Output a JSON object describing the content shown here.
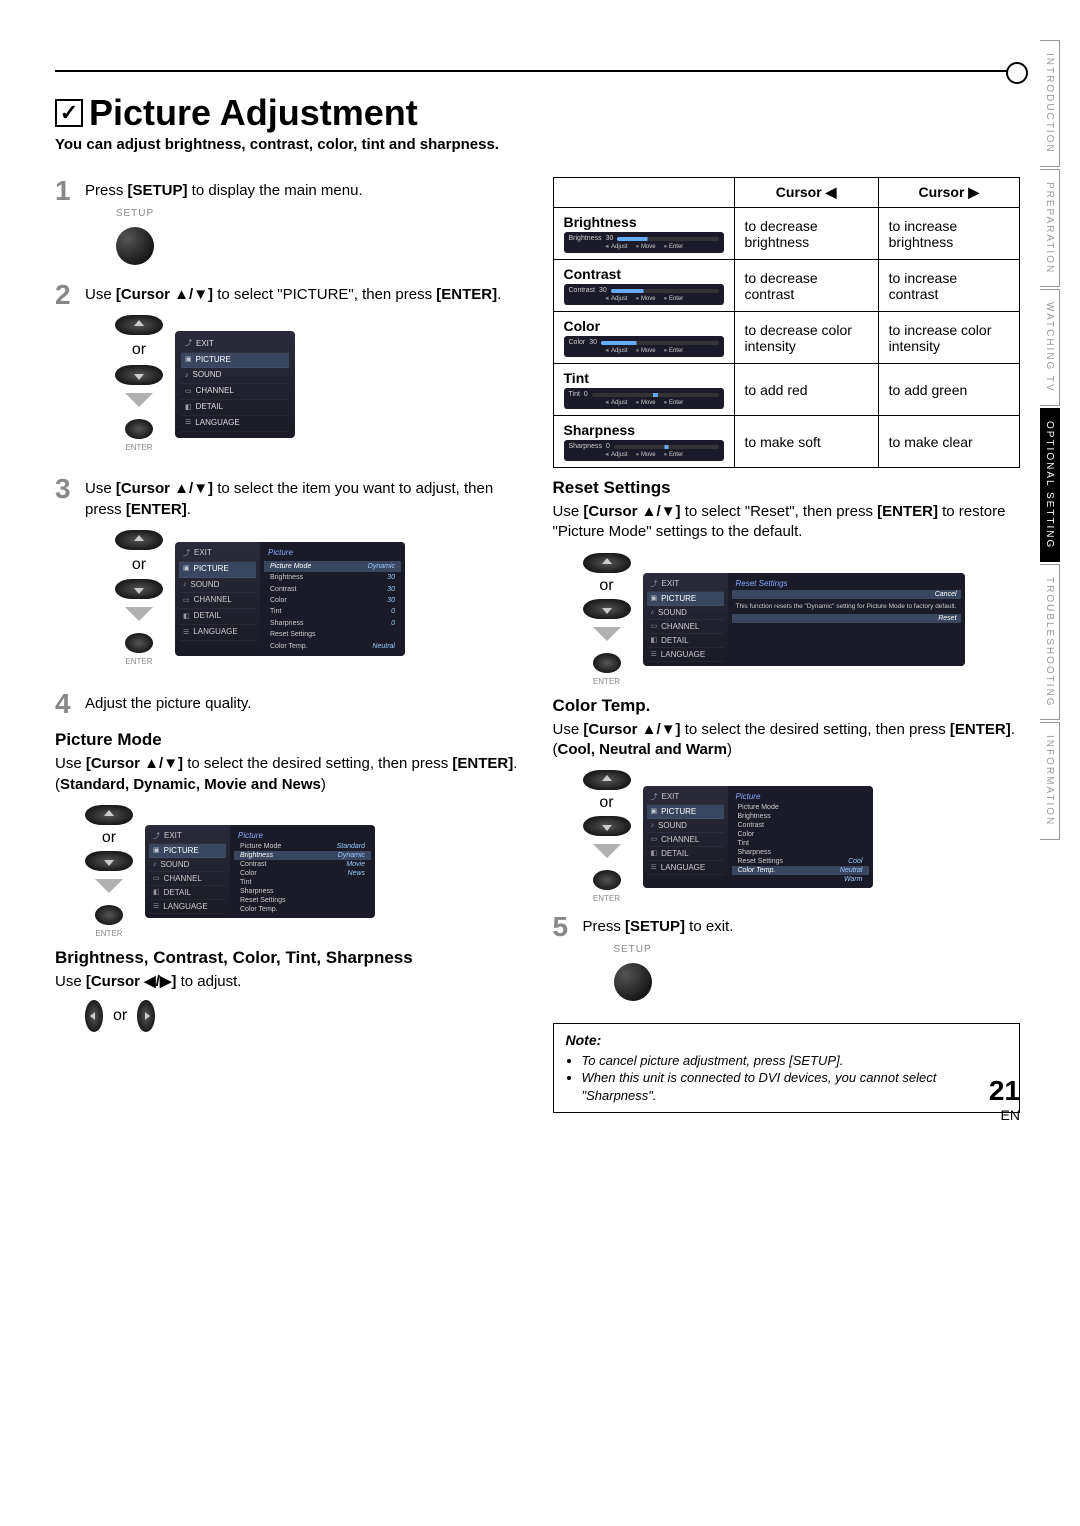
{
  "title": "Picture Adjustment",
  "subtitle": "You can adjust brightness, contrast, color, tint and sharpness.",
  "steps": {
    "s1": {
      "num": "1",
      "text_a": "Press ",
      "text_b": "[SETUP]",
      "text_c": " to display the main menu."
    },
    "s2": {
      "num": "2",
      "text_a": "Use ",
      "text_b": "[Cursor ▲/▼]",
      "text_c": " to select \"PICTURE\", then press ",
      "text_d": "[ENTER]",
      "text_e": "."
    },
    "s3": {
      "num": "3",
      "text_a": "Use ",
      "text_b": "[Cursor ▲/▼]",
      "text_c": " to select the item you want to adjust, then press ",
      "text_d": "[ENTER]",
      "text_e": "."
    },
    "s4": {
      "num": "4",
      "text": "Adjust the picture quality."
    },
    "s5": {
      "num": "5",
      "text_a": "Press ",
      "text_b": "[SETUP]",
      "text_c": " to exit."
    }
  },
  "labels": {
    "setup": "SETUP",
    "enter": "ENTER",
    "or": "or"
  },
  "osd_menu": {
    "items": [
      "EXIT",
      "PICTURE",
      "SOUND",
      "CHANNEL",
      "DETAIL",
      "LANGUAGE"
    ]
  },
  "picture_menu": {
    "title": "Picture",
    "rows": [
      {
        "label": "Picture Mode",
        "val": "Dynamic"
      },
      {
        "label": "Brightness",
        "val": "30"
      },
      {
        "label": "Contrast",
        "val": "30"
      },
      {
        "label": "Color",
        "val": "30"
      },
      {
        "label": "Tint",
        "val": "0"
      },
      {
        "label": "Sharpness",
        "val": "0"
      },
      {
        "label": "Reset Settings",
        "val": ""
      },
      {
        "label": "Color Temp.",
        "val": "Neutral"
      }
    ]
  },
  "picture_mode": {
    "heading": "Picture Mode",
    "text_a": "Use ",
    "text_b": "[Cursor ▲/▼]",
    "text_c": " to select the desired setting, then press ",
    "text_d": "[ENTER]",
    "text_e": ". (",
    "opts": "Standard, Dynamic, Movie and News",
    "text_f": ")",
    "options": [
      "Standard",
      "Dynamic",
      "Movie",
      "News"
    ]
  },
  "bcts": {
    "heading": "Brightness, Contrast, Color, Tint, Sharpness",
    "text_a": "Use ",
    "text_b": "[Cursor ◀/▶]",
    "text_c": " to adjust."
  },
  "table": {
    "hdr_left": "Cursor ◀",
    "hdr_right": "Cursor ▶",
    "rows": [
      {
        "name": "Brightness",
        "val": "30",
        "left": "to decrease brightness",
        "right": "to increase brightness"
      },
      {
        "name": "Contrast",
        "val": "30",
        "left": "to decrease contrast",
        "right": "to increase contrast"
      },
      {
        "name": "Color",
        "val": "30",
        "left": "to decrease color intensity",
        "right": "to increase color intensity"
      },
      {
        "name": "Tint",
        "val": "0",
        "left": "to add red",
        "right": "to add green"
      },
      {
        "name": "Sharpness",
        "val": "0",
        "left": "to make soft",
        "right": "to make clear"
      }
    ],
    "slider_legend": {
      "adjust": "Adjust",
      "move": "Move",
      "enter": "Enter"
    }
  },
  "reset": {
    "heading": "Reset Settings",
    "text_a": "Use ",
    "text_b": "[Cursor ▲/▼]",
    "text_c": " to select \"Reset\", then press ",
    "text_d": "[ENTER]",
    "text_e": " to restore \"Picture Mode\" settings to the default.",
    "osd_title": "Reset Settings",
    "osd_text": "This function resets the \"Dynamic\" setting for Picture Mode to factory default.",
    "cancel": "Cancel",
    "reset_btn": "Reset"
  },
  "colortemp": {
    "heading": "Color Temp.",
    "text_a": "Use ",
    "text_b": "[Cursor ▲/▼]",
    "text_c": " to select the desired setting, then press ",
    "text_d": "[ENTER]",
    "text_e": ". (",
    "opts": "Cool, Neutral and Warm",
    "text_f": ")",
    "options": [
      "Cool",
      "Neutral",
      "Warm"
    ]
  },
  "note": {
    "heading": "Note:",
    "items": [
      "To cancel picture adjustment, press [SETUP].",
      "When this unit is connected to DVI devices, you cannot select \"Sharpness\"."
    ]
  },
  "tabs": [
    "INTRODUCTION",
    "PREPARATION",
    "WATCHING TV",
    "OPTIONAL SETTING",
    "TROUBLESHOOTING",
    "INFORMATION"
  ],
  "active_tab": 3,
  "page_number": "21",
  "page_lang": "EN"
}
